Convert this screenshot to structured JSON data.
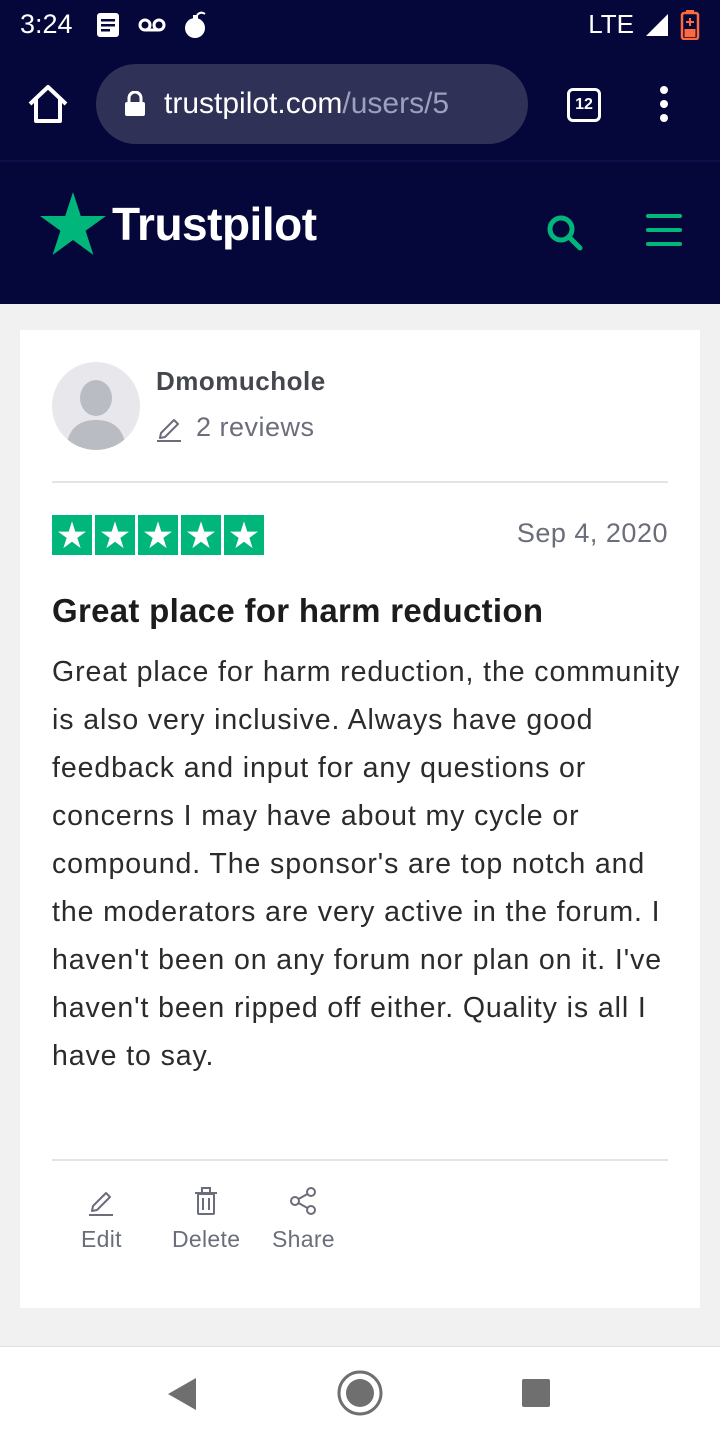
{
  "status_bar": {
    "time": "3:24",
    "network": "LTE",
    "icons": [
      "notes-icon",
      "voicemail-icon",
      "bomb-icon",
      "signal-icon",
      "battery-low-icon"
    ]
  },
  "browser": {
    "url_domain": "trustpilot.com",
    "url_path": "/users/5",
    "tab_count": "12"
  },
  "site_header": {
    "logo_text": "Trustpilot",
    "accent_color": "#00b67a",
    "background_color": "#05063a"
  },
  "review": {
    "author": "Dmomuchole",
    "review_count": "2 reviews",
    "rating": 5,
    "rating_max": 5,
    "date": "Sep 4, 2020",
    "title": "Great place for harm reduction",
    "body": "Great place for harm reduction, the community is also very inclusive. Always have good feedback and input for any questions or concerns I may have about my cycle or compound. The sponsor's are top notch and the moderators are very active in the forum. I haven't been on any forum nor plan on it. I've haven't been ripped off either. Quality is all I have to say.",
    "actions": {
      "edit": "Edit",
      "delete": "Delete",
      "share": "Share"
    }
  }
}
